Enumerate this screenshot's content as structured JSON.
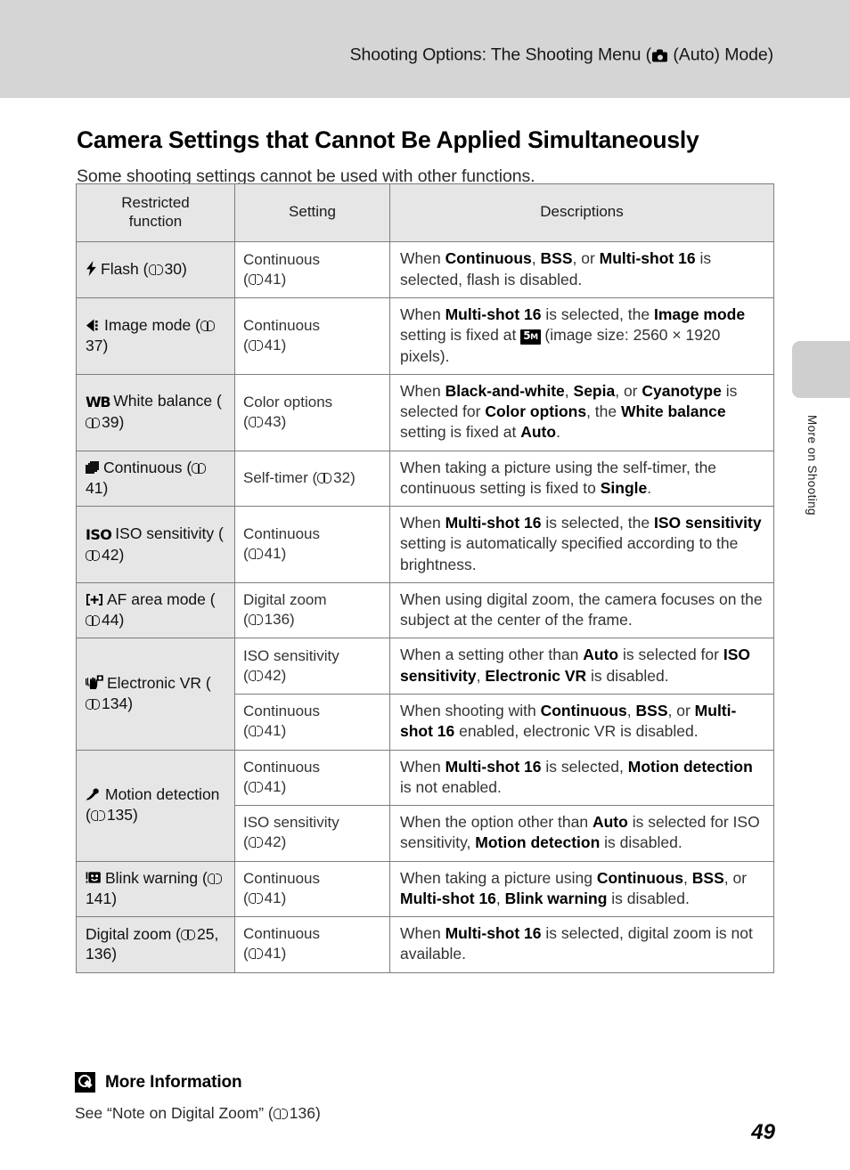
{
  "header": {
    "running_head_before": "Shooting Options: The Shooting Menu (",
    "camera_icon": "camera-icon",
    "running_head_after": " (Auto) Mode)"
  },
  "side_tab": {
    "label": "More on Shooting"
  },
  "section": {
    "title": "Camera Settings that Cannot Be Applied Simultaneously",
    "intro": "Some shooting settings cannot be used with other functions."
  },
  "table": {
    "headers": {
      "restricted_function": "Restricted\nfunction",
      "setting": "Setting",
      "descriptions": "Descriptions"
    },
    "rows": [
      {
        "icon": "flash-icon",
        "function_label": "Flash",
        "function_ref": "30",
        "setting_label": "Continuous",
        "setting_ref": "41",
        "description_parts": [
          {
            "t": "When ",
            "b": false
          },
          {
            "t": "Continuous",
            "b": true
          },
          {
            "t": ", ",
            "b": false
          },
          {
            "t": "BSS",
            "b": true
          },
          {
            "t": ", or ",
            "b": false
          },
          {
            "t": "Multi-shot 16",
            "b": true
          },
          {
            "t": " is selected, flash is disabled.",
            "b": false
          }
        ]
      },
      {
        "icon": "image-mode-icon",
        "function_label": "Image mode",
        "function_ref": "37",
        "setting_label": "Continuous",
        "setting_ref": "41",
        "description_parts": [
          {
            "t": "When ",
            "b": false
          },
          {
            "t": "Multi-shot 16",
            "b": true
          },
          {
            "t": " is selected, the ",
            "b": false
          },
          {
            "t": "Image mode",
            "b": true
          },
          {
            "t": " setting is fixed at ",
            "b": false
          },
          {
            "t": "",
            "b": false,
            "badge": "5M"
          },
          {
            "t": " (image size: 2560 × 1920 pixels).",
            "b": false
          }
        ]
      },
      {
        "icon": "white-balance-icon",
        "function_label": "White balance",
        "function_ref": "39",
        "setting_label": "Color options",
        "setting_ref": "43",
        "description_parts": [
          {
            "t": "When ",
            "b": false
          },
          {
            "t": "Black-and-white",
            "b": true
          },
          {
            "t": ", ",
            "b": false
          },
          {
            "t": "Sepia",
            "b": true
          },
          {
            "t": ", or ",
            "b": false
          },
          {
            "t": "Cyanotype",
            "b": true
          },
          {
            "t": " is selected for ",
            "b": false
          },
          {
            "t": "Color options",
            "b": true
          },
          {
            "t": ", the ",
            "b": false
          },
          {
            "t": "White balance",
            "b": true
          },
          {
            "t": " setting is fixed at ",
            "b": false
          },
          {
            "t": "Auto",
            "b": true
          },
          {
            "t": ".",
            "b": false
          }
        ]
      },
      {
        "icon": "continuous-icon",
        "function_label": "Continuous",
        "function_ref": "41",
        "setting_label": "Self-timer",
        "setting_ref": "32",
        "setting_inline": true,
        "description_parts": [
          {
            "t": "When taking a picture using the self-timer, the continuous setting is fixed to ",
            "b": false
          },
          {
            "t": "Single",
            "b": true
          },
          {
            "t": ".",
            "b": false
          }
        ]
      },
      {
        "icon": "iso-icon",
        "function_label": "ISO sensitivity",
        "function_ref": "42",
        "setting_label": "Continuous",
        "setting_ref": "41",
        "description_parts": [
          {
            "t": "When ",
            "b": false
          },
          {
            "t": "Multi-shot 16",
            "b": true
          },
          {
            "t": " is selected, the ",
            "b": false
          },
          {
            "t": "ISO sensitivity",
            "b": true
          },
          {
            "t": " setting is automatically specified according to the brightness.",
            "b": false
          }
        ]
      },
      {
        "icon": "af-area-mode-icon",
        "function_label": "AF area mode",
        "function_ref": "44",
        "setting_label": "Digital zoom",
        "setting_ref": "136",
        "description_parts": [
          {
            "t": "When using digital zoom, the camera focuses on the subject at the center of the frame.",
            "b": false
          }
        ]
      },
      {
        "icon": "electronic-vr-icon",
        "function_label": "Electronic VR",
        "function_ref": "134",
        "rowspan": 2,
        "setting_label": "ISO sensitivity",
        "setting_ref": "42",
        "description_parts": [
          {
            "t": "When a setting other than ",
            "b": false
          },
          {
            "t": "Auto",
            "b": true
          },
          {
            "t": " is selected for ",
            "b": false
          },
          {
            "t": "ISO sensitivity",
            "b": true
          },
          {
            "t": ", ",
            "b": false
          },
          {
            "t": "Electronic VR",
            "b": true
          },
          {
            "t": " is disabled.",
            "b": false
          }
        ]
      },
      {
        "continuation": true,
        "setting_label": "Continuous",
        "setting_ref": "41",
        "description_parts": [
          {
            "t": "When shooting with ",
            "b": false
          },
          {
            "t": "Continuous",
            "b": true
          },
          {
            "t": ", ",
            "b": false
          },
          {
            "t": "BSS",
            "b": true
          },
          {
            "t": ", or ",
            "b": false
          },
          {
            "t": "Multi-shot 16",
            "b": true
          },
          {
            "t": " enabled, electronic VR is disabled.",
            "b": false
          }
        ]
      },
      {
        "icon": "motion-detection-icon",
        "function_label": "Motion detection",
        "function_ref": "135",
        "rowspan": 2,
        "setting_label": "Continuous",
        "setting_ref": "41",
        "description_parts": [
          {
            "t": "When ",
            "b": false
          },
          {
            "t": "Multi-shot 16",
            "b": true
          },
          {
            "t": " is selected, ",
            "b": false
          },
          {
            "t": "Motion detection",
            "b": true
          },
          {
            "t": " is not enabled.",
            "b": false
          }
        ]
      },
      {
        "continuation": true,
        "setting_label": "ISO sensitivity",
        "setting_ref": "42",
        "description_parts": [
          {
            "t": "When the option other than ",
            "b": false
          },
          {
            "t": "Auto",
            "b": true
          },
          {
            "t": " is selected for ISO sensitivity, ",
            "b": false
          },
          {
            "t": "Motion detection",
            "b": true
          },
          {
            "t": " is disabled.",
            "b": false
          }
        ]
      },
      {
        "icon": "blink-warning-icon",
        "function_label": "Blink warning",
        "function_ref": "141",
        "setting_label": "Continuous",
        "setting_ref": "41",
        "description_parts": [
          {
            "t": "When taking a picture using ",
            "b": false
          },
          {
            "t": "Continuous",
            "b": true
          },
          {
            "t": ", ",
            "b": false
          },
          {
            "t": "BSS",
            "b": true
          },
          {
            "t": ", or ",
            "b": false
          },
          {
            "t": "Multi-shot 16",
            "b": true
          },
          {
            "t": ", ",
            "b": false
          },
          {
            "t": "Blink warning",
            "b": true
          },
          {
            "t": " is disabled.",
            "b": false
          }
        ]
      },
      {
        "icon": null,
        "function_label": "Digital zoom",
        "function_ref": "25, 136",
        "setting_label": "Continuous",
        "setting_ref": "41",
        "description_parts": [
          {
            "t": "When ",
            "b": false
          },
          {
            "t": "Multi-shot 16",
            "b": true
          },
          {
            "t": " is selected, digital zoom is not available.",
            "b": false
          }
        ]
      }
    ]
  },
  "more_information": {
    "title": "More Information",
    "body_before": "See “Note on Digital Zoom” (",
    "body_ref": "136",
    "body_after": ")"
  },
  "page_number": "49",
  "colors": {
    "header_band": "#d5d5d5",
    "table_header_bg": "#e6e6e6",
    "first_column_bg": "#e6e6e6",
    "border": "#7d7d7d",
    "side_tab": "#cfcfcf"
  }
}
